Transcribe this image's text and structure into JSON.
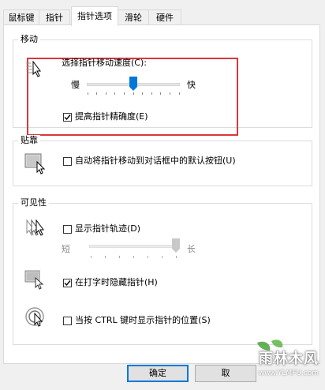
{
  "tabs": [
    {
      "label": "鼠标键"
    },
    {
      "label": "指针"
    },
    {
      "label": "指针选项"
    },
    {
      "label": "滑轮"
    },
    {
      "label": "硬件"
    }
  ],
  "active_tab": "指针选项",
  "motion": {
    "title": "移动",
    "speed_label": "选择指针移动速度(C):",
    "slow": "慢",
    "fast": "快",
    "speed_value": 0.5,
    "precision_label": "提高指针精确度(E)",
    "precision_checked": true
  },
  "snap": {
    "title": "贴靠",
    "label": "自动将指针移动到对话框中的默认按钮(U)",
    "checked": false
  },
  "visibility": {
    "title": "可见性",
    "trails_label": "显示指针轨迹(D)",
    "trails_checked": false,
    "short": "短",
    "long": "长",
    "trails_value": 1.0,
    "hide_label": "在打字时隐藏指针(H)",
    "hide_checked": true,
    "ctrl_label": "当按 CTRL 键时显示指针的位置(S)",
    "ctrl_checked": false
  },
  "buttons": {
    "ok": "确定",
    "cancel": "取"
  },
  "watermark": {
    "text": "雨林木风",
    "url": "www.YLMFU.com"
  },
  "colors": {
    "highlight": "#d6383f",
    "thumb": "#0078d7",
    "thumb_disabled": "#c8c8c8"
  }
}
